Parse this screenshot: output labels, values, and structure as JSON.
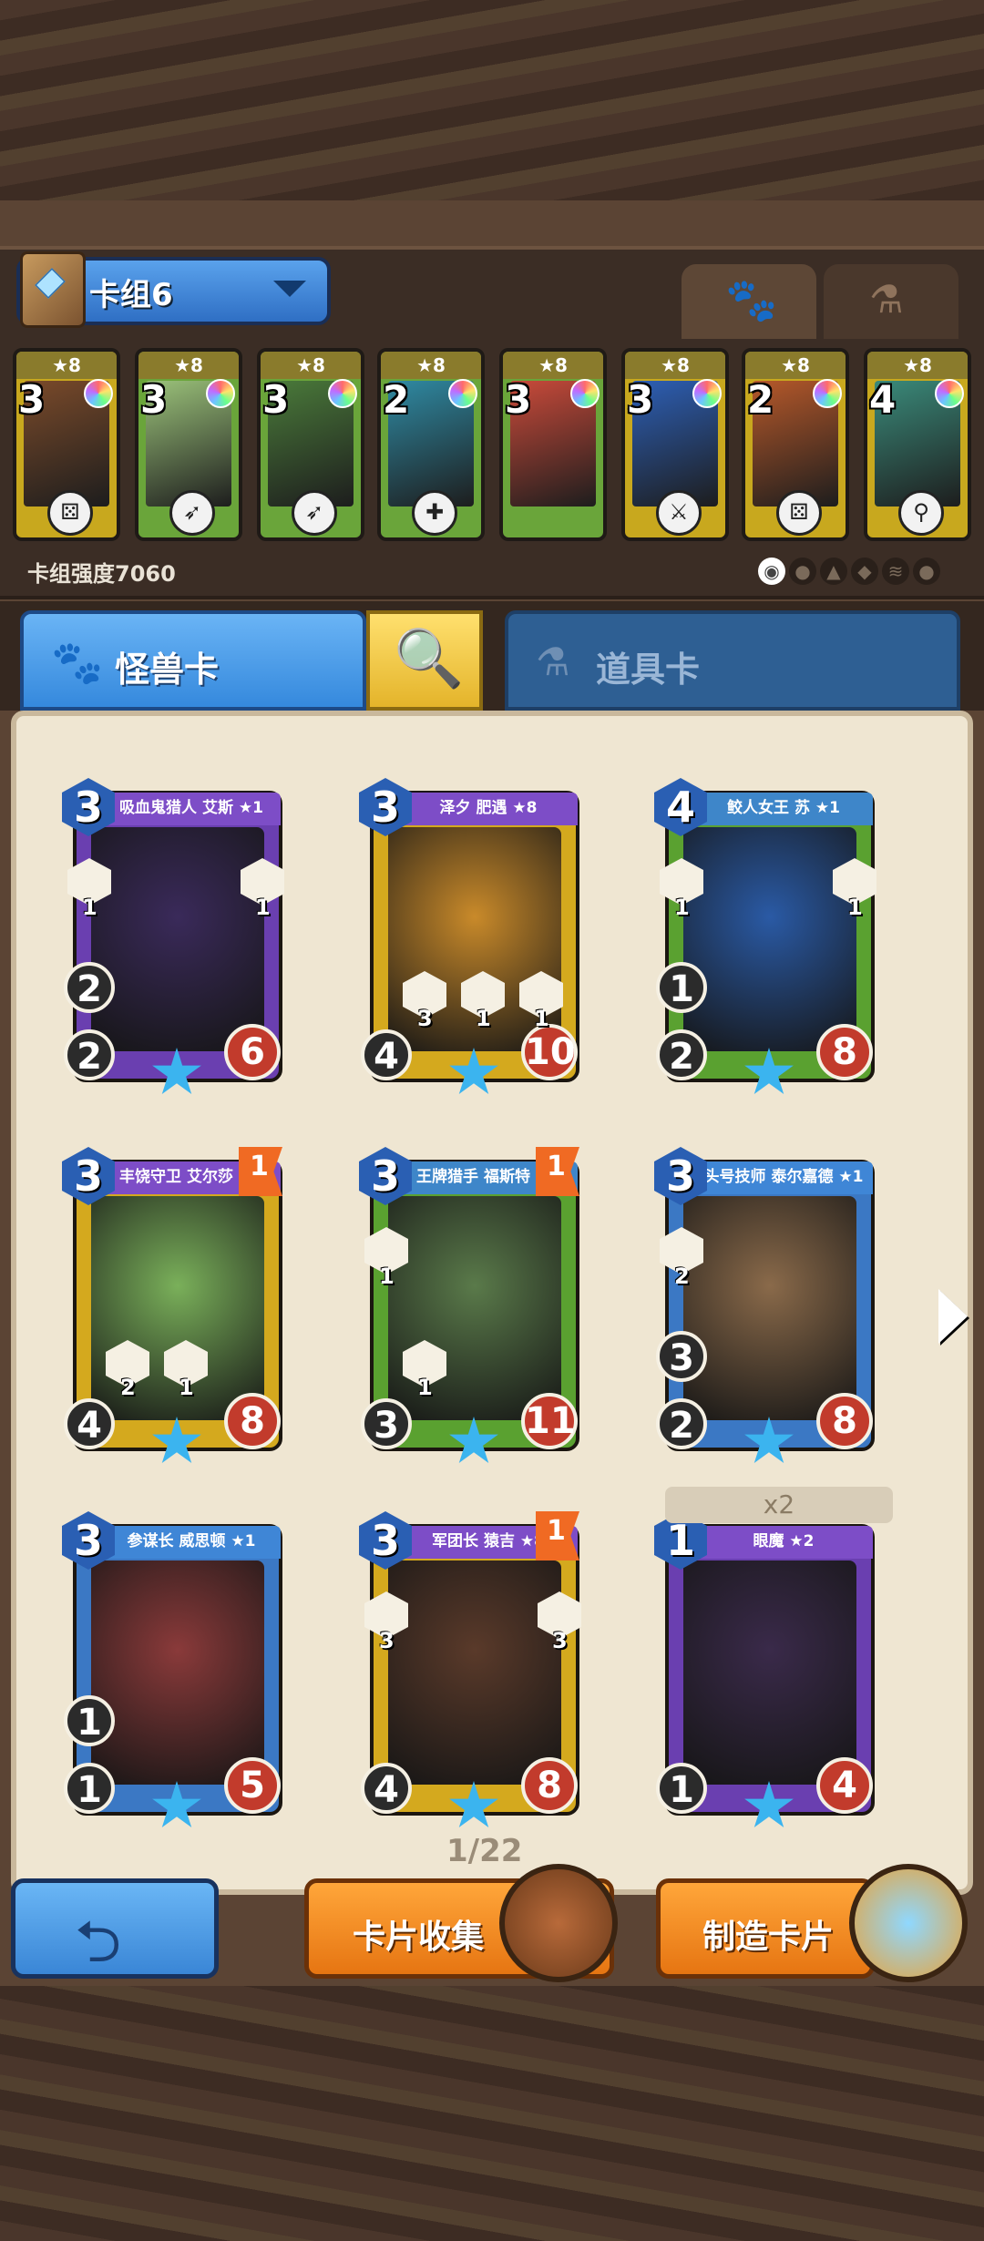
{
  "deck": {
    "name": "卡组6",
    "power_label": "卡组强度7060",
    "cards": [
      {
        "cost": "3",
        "star": "★8",
        "color": "yellow",
        "footer_icon": "dice-icon",
        "art": "#7a4a2a"
      },
      {
        "cost": "3",
        "star": "★8",
        "color": "green",
        "footer_icon": "bow-icon",
        "art": "#9bc27a"
      },
      {
        "cost": "3",
        "star": "★8",
        "color": "green",
        "footer_icon": "bow-icon",
        "art": "#4a7a3a"
      },
      {
        "cost": "2",
        "star": "★8",
        "color": "green",
        "footer_icon": "heal-icon",
        "art": "#2f8aa3"
      },
      {
        "cost": "3",
        "star": "★8",
        "color": "green",
        "footer_icon": "",
        "art": "#c94a3a"
      },
      {
        "cost": "3",
        "star": "★8",
        "color": "yellow",
        "footer_icon": "sword-icon",
        "art": "#2d5fb5"
      },
      {
        "cost": "2",
        "star": "★8",
        "color": "yellow",
        "footer_icon": "dice-icon",
        "art": "#b5582a"
      },
      {
        "cost": "4",
        "star": "★8",
        "color": "yellow",
        "footer_icon": "staff-icon",
        "art": "#3a8a7a"
      }
    ]
  },
  "tabs": {
    "monster": "怪兽卡",
    "item": "道具卡"
  },
  "cards": [
    {
      "name": "吸血鬼猎人 艾斯 ★1",
      "cost": "3",
      "attack": "2",
      "ranged": "2",
      "hp": "6",
      "frame": "purple",
      "art": "#3a2a5a",
      "flag": "",
      "chips": [
        "1",
        "1"
      ],
      "chip_nums": []
    },
    {
      "name": "泽夕 肥遇 ★8",
      "cost": "3",
      "attack": "",
      "ranged": "4",
      "hp": "10",
      "frame": "gold",
      "art": "#c98a2a",
      "flag": "",
      "chips": [],
      "chip_nums": [
        "3",
        "1",
        "1"
      ]
    },
    {
      "name": "鲛人女王 苏 ★1",
      "cost": "4",
      "attack": "1",
      "ranged": "2",
      "hp": "8",
      "frame": "green",
      "art": "#2a5aa5",
      "flag": "",
      "chips": [
        "1",
        "1"
      ],
      "chip_nums": []
    },
    {
      "name": "丰饶守卫 艾尔莎 ★8",
      "cost": "3",
      "attack": "",
      "ranged": "4",
      "hp": "8",
      "frame": "gold",
      "art": "#7ab05a",
      "flag": "1",
      "chips": [],
      "chip_nums": [
        "2",
        "1"
      ]
    },
    {
      "name": "王牌猎手 福斯特 ★8",
      "cost": "3",
      "attack": "",
      "ranged": "3",
      "hp": "11",
      "frame": "green",
      "art": "#5a7a4a",
      "flag": "1",
      "chips": [
        "1"
      ],
      "chip_nums": [
        "1"
      ]
    },
    {
      "name": "头号技师 泰尔嘉德 ★1",
      "cost": "3",
      "attack": "3",
      "ranged": "2",
      "hp": "8",
      "frame": "blue",
      "art": "#8a6a4a",
      "flag": "",
      "chips": [
        "2"
      ],
      "chip_nums": []
    },
    {
      "name": "参谋长 威思顿 ★1",
      "cost": "3",
      "attack": "1",
      "ranged": "1",
      "hp": "5",
      "frame": "blue",
      "art": "#8a3a3a",
      "flag": "",
      "chips": [],
      "chip_nums": []
    },
    {
      "name": "军团长 猿吉 ★8",
      "cost": "3",
      "attack": "",
      "ranged": "4",
      "hp": "8",
      "frame": "gold",
      "art": "#5a3a2a",
      "flag": "1",
      "chips": [
        "3",
        "3"
      ],
      "chip_nums": []
    },
    {
      "name": "眼魔 ★2",
      "cost": "1",
      "attack": "",
      "ranged": "1",
      "hp": "4",
      "frame": "purple",
      "art": "#3a2a4a",
      "flag": "",
      "chips": [],
      "chip_nums": [],
      "count": "x2"
    }
  ],
  "pagination": "1/22",
  "buttons": {
    "collection": "卡片收集",
    "craft": "制造卡片"
  }
}
